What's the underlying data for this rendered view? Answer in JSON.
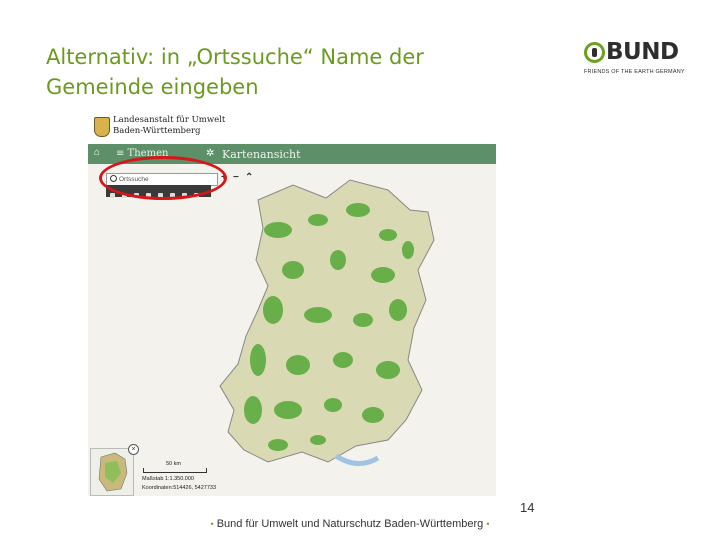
{
  "slide": {
    "title_line1": "Alternativ: in „Ortssuche“ Name der",
    "title_line2": "Gemeinde eingeben",
    "page_number": "14",
    "footer_text": "Bund für Umwelt und Naturschutz  Baden-Württemberg"
  },
  "logo": {
    "word": "BUND",
    "tagline": "FRIENDS OF THE EARTH GERMANY"
  },
  "screenshot": {
    "agency_line1": "Landesanstalt für Umwelt",
    "agency_line2": "Baden-Württemberg",
    "nav_home_icon": "home-icon",
    "nav_themen": "≡ Themen",
    "nav_kartenansicht": "Kartenansicht",
    "search_placeholder": "Ortssuche",
    "zoom_in": "+",
    "zoom_out": "−",
    "collapse": "⌃",
    "scale_label": "50 km",
    "massstab": "Maßstab 1:1.350.000",
    "coordinates": "Koordinaten:514426, 5427733"
  },
  "colors": {
    "title_green": "#6a9a1f",
    "map_green": "#5cab3f",
    "nav_green": "#5d8f69",
    "highlight_red": "#d5161b"
  }
}
